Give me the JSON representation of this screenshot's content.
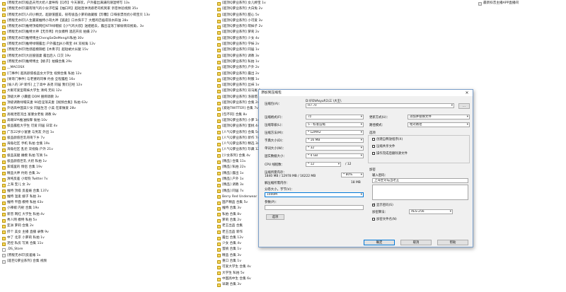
{
  "left_list": [
    {
      "icon": "folder",
      "text": "[原版无水印]极品天然大奶人妻导购【Q奈】今天寡欢，户外露出满满的潮湿特写 13v"
    },
    {
      "icon": "folder",
      "text": "[原版无水印]最有钱气的小伙子吃猫【抽口鸡】超短连体诱惑老司机到家 亲密体验视频 35v"
    },
    {
      "icon": "folder",
      "text": "[原版无水印]人间小精灵，超颜值甜美，很有极品小萝莉收藏版【珍馨】口嗨很漂亮奶小萌宝贝 13v"
    },
    {
      "icon": "folder",
      "text": "[原版无水印]人生赢家推特小哥大神【狐柔】口水快干了 大粗鸡巴插得浪水四溢 28v"
    },
    {
      "icon": "folder",
      "text": "[原版无水印]推特顶级网红NTR绿帽奴【小气鸡大叔】送姐姐去，露出淫荡了解偷情双视角，3v"
    },
    {
      "icon": "folder",
      "text": "[原版无水印]推特大神【无奈青】约女模特 酒店开房 拍摄 27v"
    },
    {
      "icon": "folder",
      "text": "[原版无水印]推特博主ChengSeDeMengXi私拍 30v"
    },
    {
      "icon": "folder",
      "text": "[原版无水印]推特绿帽露出 户外露出JK小萌宝 4K 双视角 12v"
    },
    {
      "icon": "folder",
      "text": "[原版无水印]性感超模御姐【木青子】超短裙大长腿 15v"
    },
    {
      "icon": "folder",
      "text": "[原版无水印]大屁股骚妻 露出后入 口交 19v"
    },
    {
      "icon": "folder",
      "text": "[原版无水印]推特博主【桃子】拍摄合集 29v"
    },
    {
      "icon": "folder",
      "text": "__MACOSX"
    },
    {
      "icon": "folder",
      "text": "[门事件] 超高颜值极品女大学生 视频合集 私拍 12v"
    },
    {
      "icon": "folder",
      "text": "[果哥门事件] 与老婆的同事 约会 全程露脸 16v"
    },
    {
      "icon": "folder",
      "text": "[偷人的 3P 新作] 上了高中 表弟 同居 我们已经 12v"
    },
    {
      "icon": "folder",
      "text": "大眼可爱型萌妹大学生 清纯 无码 12v"
    },
    {
      "icon": "folder",
      "text": "顶级大神 小麋鹿 DOM 捆绑调教 3v"
    },
    {
      "icon": "folder",
      "text": "顶级调教绿帽夫妻 90后淫荡夫妻【视频合集】私拍 63v"
    },
    {
      "icon": "folder",
      "text": "外语高中国美少女 同居生活 小美 在家做爱 28v"
    },
    {
      "icon": "folder",
      "text": "高端泄密流出 富婆女老板 调教 8v"
    },
    {
      "icon": "folder",
      "text": "高端SPA推油按摩 偷拍 10v"
    },
    {
      "icon": "folder",
      "text": "极品露脸大学生 可爱 同居 日常 4v"
    },
    {
      "icon": "folder",
      "text": "广东22岁小富婆 与男友 外出 1v"
    },
    {
      "icon": "folder",
      "text": "极品颜值巨乳哥哥下乡 7v"
    },
    {
      "icon": "folder",
      "text": "海角社区 手机 私拍 合集 19v"
    },
    {
      "icon": "folder",
      "text": "海角社区 乱伦 双视角 户外 21v"
    },
    {
      "icon": "folder",
      "text": "极品美腿 嫩模 私拍 写真 5v"
    },
    {
      "icon": "folder",
      "text": "极品颜值巨乳 大奶 私拍 1v"
    },
    {
      "icon": "folder",
      "text": "家城里的 情侣 合集 19v"
    },
    {
      "icon": "folder",
      "text": "精品大神 约炮 合集 3v"
    },
    {
      "icon": "folder",
      "text": "清纯反差 小母狗 Twitter 7v"
    },
    {
      "icon": "folder",
      "text": "上海 宝儿 女 3v"
    },
    {
      "icon": "folder",
      "text": "推特 顶级 反差婊 合集 137v"
    },
    {
      "icon": "folder",
      "text": "推特 温柔 嫂子 私拍 3v"
    },
    {
      "icon": "folder",
      "text": "推特 平面 模特 私拍 63v"
    },
    {
      "icon": "folder",
      "text": "小辣椒 内射 合集 19v"
    },
    {
      "icon": "folder",
      "text": "新晋 网红 大学生 私拍 4v"
    },
    {
      "icon": "folder",
      "text": "秀人网 模特 私拍 5v"
    },
    {
      "icon": "folder",
      "text": "亚洲 萝莉 合集 2v"
    },
    {
      "icon": "folder",
      "text": "挤个 美女 主播 直播 录像 9v"
    },
    {
      "icon": "folder",
      "text": "中了 北京 小萝莉 私拍 1v"
    },
    {
      "icon": "folder",
      "text": "足控 私房 写真 合集 11v"
    },
    {
      "icon": "file",
      "text": ".DS_Store"
    },
    {
      "icon": "video",
      "text": "[原版无水印]反差婊 1v"
    },
    {
      "icon": "video",
      "text": "[超巨Q萝业系列] 合集 视频"
    }
  ],
  "mid_list": [
    {
      "icon": "folder",
      "text": "[超顶Q萝业系列] 女儿婷宝 1v"
    },
    {
      "icon": "folder",
      "text": "[超顶Q萝业系列] 大白兔 2v"
    },
    {
      "icon": "folder",
      "text": "[超顶Q萝业系列] 甜心 5v"
    },
    {
      "icon": "folder",
      "text": "[超顶Q萝业系列] 小可爱 3v"
    },
    {
      "icon": "folder",
      "text": "[超顶Q萝业系列] 萌妹子 2v"
    },
    {
      "icon": "folder",
      "text": "[超顶Q萝业系列] 萝莉 2v"
    },
    {
      "icon": "folder",
      "text": "[超顶Q萝业系列] 少女 4v"
    },
    {
      "icon": "folder",
      "text": "[超顶Q萝业系列] 学妹 2v"
    },
    {
      "icon": "folder",
      "text": "[超顶Q萝业系列] 同居 1v"
    },
    {
      "icon": "folder",
      "text": "[超顶Q萝业系列] 调教 3v"
    },
    {
      "icon": "folder",
      "text": "[超顶Q萝业系列] 私拍 1v"
    },
    {
      "icon": "folder",
      "text": "[超顶Q萝业系列] 户外 2v"
    },
    {
      "icon": "folder",
      "text": "[超顶Q萝业系列] 露出 2v"
    },
    {
      "icon": "folder",
      "text": "[超顶Q萝业系列] 制服 1v"
    },
    {
      "icon": "folder",
      "text": "[超顶Q萝业系列] 丝袜 1v"
    },
    {
      "icon": "folder",
      "text": "[超顶Q萝业系列] 双马尾 2v"
    },
    {
      "icon": "folder",
      "text": "[超顶Q萝业系列] 洛丽塔 3v"
    },
    {
      "icon": "folder",
      "text": "[超顶Q萝业系列] 合集 2v"
    },
    {
      "icon": "folder",
      "text": "[紧贴TWITTER] 合集 7v"
    },
    {
      "icon": "folder",
      "text": "[包不同] 合集 8v"
    },
    {
      "icon": "folder",
      "text": "[超顶Q萝业系列] 小萝 1v"
    },
    {
      "icon": "folder",
      "text": "[超顶Q萝业系列] 蜜桃 4v"
    },
    {
      "icon": "folder",
      "text": "[人气Q萝业系列] 合集 5v"
    },
    {
      "icon": "folder",
      "text": "[人气Q萝业系列] 新作 7v"
    },
    {
      "icon": "folder",
      "text": "[人气Q萝业系列] 精选 3v"
    },
    {
      "icon": "folder",
      "text": "[人气Q萝业系列] 珍藏 12v"
    },
    {
      "icon": "folder",
      "text": "[少女系列] 合集 4v"
    },
    {
      "icon": "folder",
      "text": "[精品] 合集 11v"
    },
    {
      "icon": "folder",
      "text": "[精品] 私拍 22v"
    },
    {
      "icon": "folder",
      "text": "[精品] 露出 1v"
    },
    {
      "icon": "folder",
      "text": "[精品] 户外 1v"
    },
    {
      "icon": "folder",
      "text": "[精品] 调教 3v"
    },
    {
      "icon": "folder",
      "text": "[精品] 同居 7v"
    },
    {
      "icon": "folder",
      "text": "Berry Red Underwear 合集"
    },
    {
      "icon": "folder",
      "text": "国产精品 合集 5v"
    },
    {
      "icon": "folder",
      "text": "推特 合集 3v"
    },
    {
      "icon": "folder",
      "text": "私拍 合集 8v"
    },
    {
      "icon": "folder",
      "text": "萝莉 合集 2v"
    },
    {
      "icon": "folder",
      "text": "老王出品 合集"
    },
    {
      "icon": "folder",
      "text": "老王出品 新作"
    },
    {
      "icon": "folder",
      "text": "露出 合集 12v"
    },
    {
      "icon": "folder",
      "text": "少女 合集 4v"
    },
    {
      "icon": "folder",
      "text": "蜜桃 合集 1v"
    },
    {
      "icon": "folder",
      "text": "精品 合集 3v"
    },
    {
      "icon": "folder",
      "text": "重口 合集 1v"
    },
    {
      "icon": "folder",
      "text": "可爱大学生 合集 4v"
    },
    {
      "icon": "folder",
      "text": "大学生 私拍 5v"
    },
    {
      "icon": "folder",
      "text": "中国高中生 合集 6v"
    },
    {
      "icon": "folder",
      "text": "早期 合集 3v"
    }
  ],
  "right_list": [
    {
      "icon": "video",
      "text": "最新抖音主播APP直播间"
    }
  ],
  "dialog": {
    "title": "添加到压缩包",
    "close_glyph": "✕",
    "labels": {
      "archive_name": "压缩包(A)：",
      "archive_format": "压缩格式(F)：",
      "compression_level": "压缩等级(L)：",
      "compression_method": "压缩方法(M)：",
      "dictionary_size": "字典大小(D)：",
      "word_size": "单词大小(W)：",
      "solid_block_size": "固实数据大小：",
      "cpu_threads": "CPU 线程数：",
      "memory_compress": "压缩所需内存：",
      "memory_decompress": "解压缩所需内存：",
      "split_volumes": "分卷大小，字节(V)：",
      "parameters": "参数(P)：",
      "update_mode": "更新方式(U)：",
      "path_mode": "路径模式：",
      "options": "选项",
      "encryption": "加密",
      "enter_password": "输入密码：",
      "reenter_password": "重新输入密码：",
      "encryption_method": "加密算法："
    },
    "values": {
      "archive_path": "D:\\FOVAsyuf\\1\\三 \\大王\\",
      "archive_name": "H7.7z",
      "archive_format": "7z",
      "compression_level": "5 - 标准压缩",
      "compression_method": "* LZMA2",
      "dictionary_size": "* 16 MB",
      "word_size": "* 32",
      "solid_block_size": "* 4 GB",
      "cpu_threads": "* 12",
      "cpu_threads_total": "/ 12",
      "memory_compress_text": "1840 MB / 12978 MB / 16222 MB",
      "memory_percent": "* 80%",
      "memory_decompress_text": "18 MB",
      "split_volumes": "1000M",
      "parameters": "",
      "update_mode": "添加并替换文件",
      "path_mode": "相对路径",
      "password": "上海主论坛当老王",
      "encryption_method": "AES-256"
    },
    "options": [
      {
        "label": "创建自释放程序(X)",
        "checked": false
      },
      {
        "label": "压缩共享文件",
        "checked": false
      },
      {
        "label": "操作完成后删除源文件",
        "checked": false
      }
    ],
    "show_password": {
      "label": "显示密码(S)",
      "checked": true
    },
    "encrypt_names": {
      "label": "加密文件名(N)",
      "checked": false
    },
    "buttons": {
      "options": "选项",
      "ok": "确定",
      "cancel": "取消",
      "help": "帮助"
    },
    "browse": "..."
  }
}
